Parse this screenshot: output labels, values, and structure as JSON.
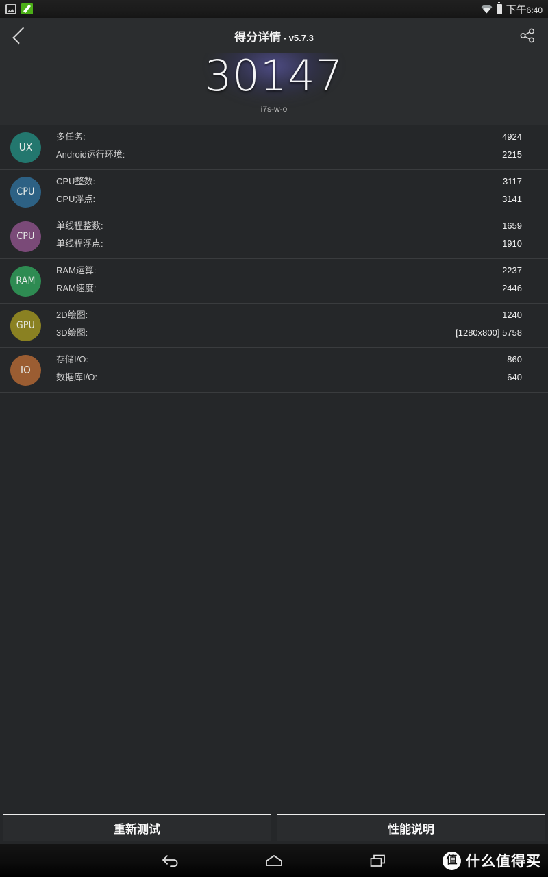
{
  "statusbar": {
    "icons": [
      "screenshot-icon",
      "antutu-app-icon",
      "wifi-icon",
      "battery-icon"
    ],
    "time": "6:40",
    "ampm": "下午"
  },
  "actionbar": {
    "back_label": "back-icon",
    "title": "得分详情",
    "separator": " - ",
    "version": "v5.7.3",
    "share_label": "share-icon"
  },
  "hero": {
    "score": "30147",
    "device": "i7s-w-o"
  },
  "groups": [
    {
      "badge": "UX",
      "color": "#23776e",
      "metrics": [
        {
          "label": "多任务:",
          "value": "4924"
        },
        {
          "label": "Android运行环境:",
          "value": "2215"
        }
      ]
    },
    {
      "badge": "CPU",
      "color": "#2d6184",
      "metrics": [
        {
          "label": "CPU整数:",
          "value": "3117"
        },
        {
          "label": "CPU浮点:",
          "value": "3141"
        }
      ]
    },
    {
      "badge": "CPU",
      "color": "#7a4a78",
      "metrics": [
        {
          "label": "单线程整数:",
          "value": "1659"
        },
        {
          "label": "单线程浮点:",
          "value": "1910"
        }
      ]
    },
    {
      "badge": "RAM",
      "color": "#2e8b52",
      "metrics": [
        {
          "label": "RAM运算:",
          "value": "2237"
        },
        {
          "label": "RAM速度:",
          "value": "2446"
        }
      ]
    },
    {
      "badge": "GPU",
      "color": "#8a8122",
      "metrics": [
        {
          "label": "2D绘图:",
          "value": "1240"
        },
        {
          "label": "3D绘图:",
          "value": "[1280x800] 5758"
        }
      ]
    },
    {
      "badge": "IO",
      "color": "#9b5d32",
      "metrics": [
        {
          "label": "存储I/O:",
          "value": "860"
        },
        {
          "label": "数据库I/O:",
          "value": "640"
        }
      ]
    }
  ],
  "buttons": {
    "retest": "重新测试",
    "performance_info": "性能说明"
  },
  "navbar": {
    "back": "nav-back-icon",
    "home": "nav-home-icon",
    "recents": "nav-recents-icon"
  },
  "watermark": {
    "logo_char": "值",
    "text": "什么值得买"
  }
}
